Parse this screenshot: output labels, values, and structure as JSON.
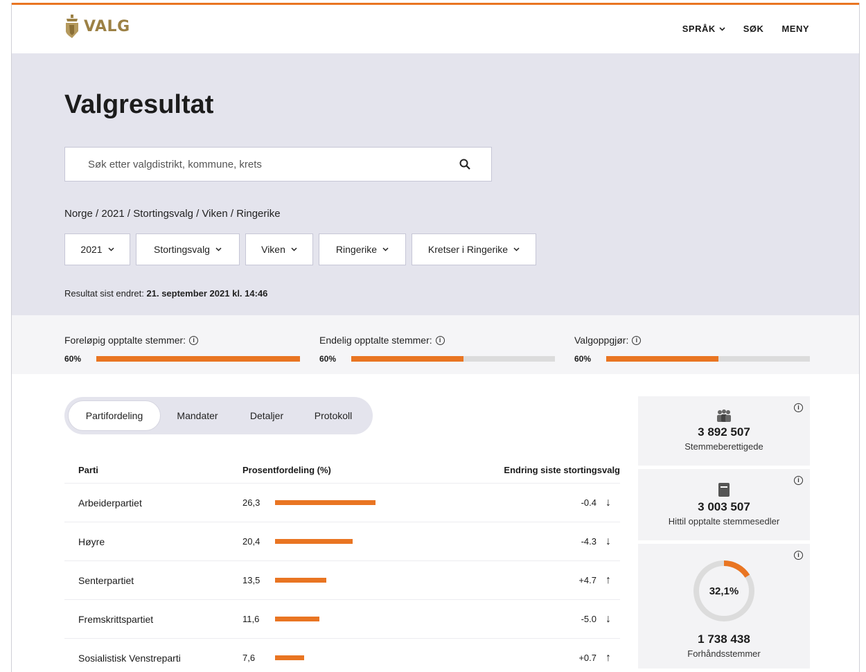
{
  "header": {
    "logo_text": "VALG",
    "nav": [
      {
        "label": "SPRÅK",
        "icon": "chevron-down-icon"
      },
      {
        "label": "SØK"
      },
      {
        "label": "MENY"
      }
    ]
  },
  "hero": {
    "title": "Valgresultat",
    "search_placeholder": "Søk etter valgdistrikt, kommune, krets",
    "breadcrumb": "Norge / 2021 / Stortingsvalg / Viken / Ringerike",
    "filters": [
      "2021",
      "Stortingsvalg",
      "Viken",
      "Ringerike",
      "Kretser i Ringerike"
    ],
    "updated_label": "Resultat sist endret:",
    "updated_value": "21. september 2021 kl. 14:46"
  },
  "progress": [
    {
      "label": "Foreløpig opptalte stemmer:",
      "pct_label": "60%",
      "fill": 1.0
    },
    {
      "label": "Endelig opptalte stemmer:",
      "pct_label": "60%",
      "fill": 0.55
    },
    {
      "label": "Valgoppgjør:",
      "pct_label": "60%",
      "fill": 0.55
    }
  ],
  "tabs": [
    "Partifordeling",
    "Mandater",
    "Detaljer",
    "Protokoll"
  ],
  "table": {
    "headers": [
      "Parti",
      "Prosentfordeling (%)",
      "Endring siste stortingsvalg"
    ],
    "rows": [
      {
        "party": "Arbeiderpartiet",
        "pct": "26,3",
        "pct_value": 26.3,
        "change": "-0.4",
        "direction": "down"
      },
      {
        "party": "Høyre",
        "pct": "20,4",
        "pct_value": 20.4,
        "change": "-4.3",
        "direction": "down"
      },
      {
        "party": "Senterpartiet",
        "pct": "13,5",
        "pct_value": 13.5,
        "change": "+4.7",
        "direction": "up"
      },
      {
        "party": "Fremskrittspartiet",
        "pct": "11,6",
        "pct_value": 11.6,
        "change": "-5.0",
        "direction": "down"
      },
      {
        "party": "Sosialistisk Venstreparti",
        "pct": "7,6",
        "pct_value": 7.6,
        "change": "+0.7",
        "direction": "up"
      }
    ]
  },
  "cards": [
    {
      "value": "3 892 507",
      "label": "Stemmeberettigede",
      "icon": "people-icon"
    },
    {
      "value": "3 003 507",
      "label": "Hittil opptalte stemmesedler",
      "icon": "ballot-icon"
    },
    {
      "value": "1 738 438",
      "label": "Forhåndsstemmer",
      "donut_label": "32,1%",
      "donut_fraction": 0.16
    }
  ],
  "colors": {
    "accent": "#e97522",
    "hero_bg": "#e4e4ed",
    "logo": "#9c8145"
  }
}
